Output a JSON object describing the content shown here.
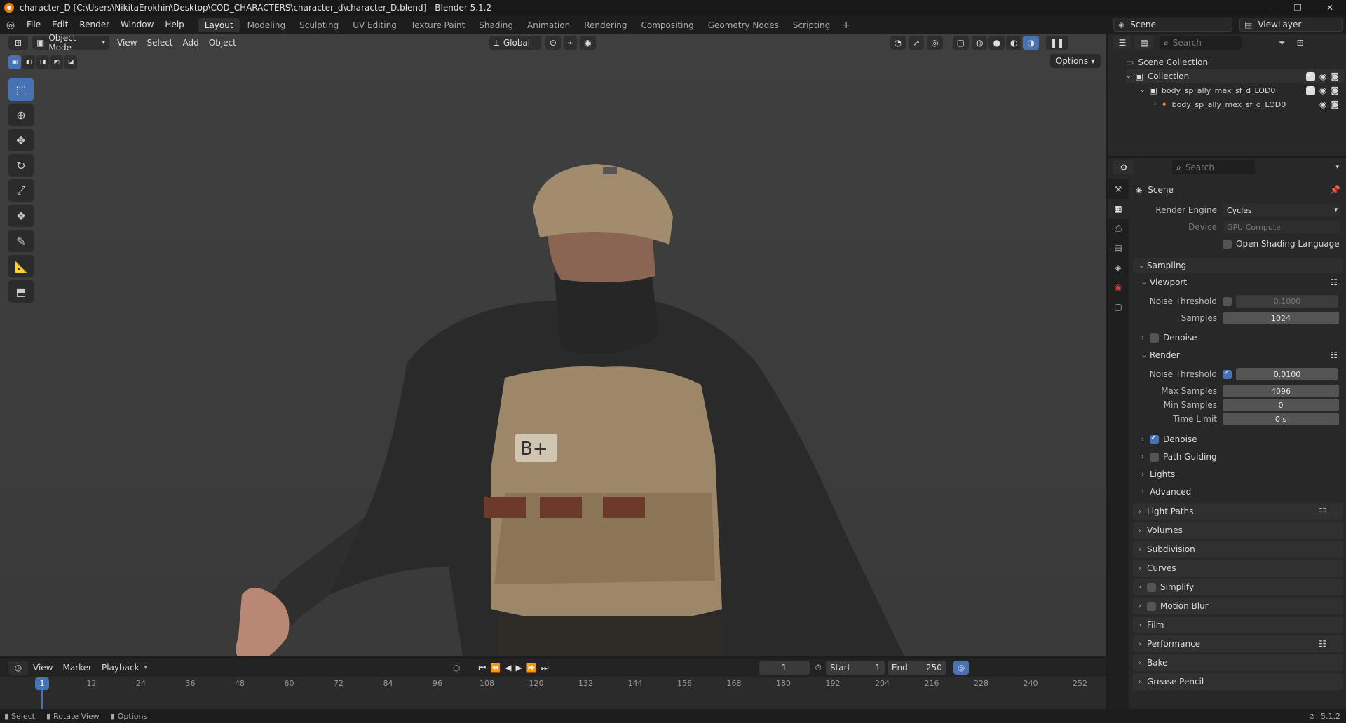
{
  "title": "character_D [C:\\Users\\NikitaErokhin\\Desktop\\COD_CHARACTERS\\character_d\\character_D.blend] - Blender 5.1.2",
  "menus": [
    "File",
    "Edit",
    "Render",
    "Window",
    "Help"
  ],
  "workspaces": [
    "Layout",
    "Modeling",
    "Sculpting",
    "UV Editing",
    "Texture Paint",
    "Shading",
    "Animation",
    "Rendering",
    "Compositing",
    "Geometry Nodes",
    "Scripting"
  ],
  "scene": {
    "name": "Scene",
    "view_layer": "ViewLayer"
  },
  "viewport": {
    "mode": "Object Mode",
    "menus": [
      "View",
      "Select",
      "Add",
      "Object"
    ],
    "transform": "Global",
    "options": "Options"
  },
  "outliner": {
    "search_placeholder": "Search",
    "root": "Scene Collection",
    "collection": "Collection",
    "object": "body_sp_ally_mex_sf_d_LOD0",
    "armature": "body_sp_ally_mex_sf_d_LOD0"
  },
  "props": {
    "search_placeholder": "Search",
    "context": "Scene",
    "render_engine_label": "Render Engine",
    "render_engine": "Cycles",
    "device_label": "Device",
    "device": "GPU Compute",
    "osl": "Open Shading Language",
    "sampling": "Sampling",
    "viewport": "Viewport",
    "vp_noise_label": "Noise Threshold",
    "vp_noise": "0.1000",
    "vp_samples_label": "Samples",
    "vp_samples": "1024",
    "denoise": "Denoise",
    "render": "Render",
    "r_noise_label": "Noise Threshold",
    "r_noise": "0.0100",
    "max_samples_label": "Max Samples",
    "max_samples": "4096",
    "min_samples_label": "Min Samples",
    "min_samples": "0",
    "time_limit_label": "Time Limit",
    "time_limit": "0 s",
    "r_denoise": "Denoise",
    "path_guiding": "Path Guiding",
    "lights": "Lights",
    "advanced": "Advanced",
    "panels": [
      "Light Paths",
      "Volumes",
      "Subdivision",
      "Curves",
      "Simplify",
      "Motion Blur",
      "Film",
      "Performance",
      "Bake",
      "Grease Pencil"
    ]
  },
  "timeline": {
    "menus": [
      "View",
      "Marker",
      "Playback"
    ],
    "current_frame": "1",
    "start_label": "Start",
    "start": "1",
    "end_label": "End",
    "end": "250",
    "ticks": [
      "12",
      "24",
      "36",
      "48",
      "60",
      "72",
      "84",
      "96",
      "108",
      "120",
      "132",
      "144",
      "156",
      "168",
      "180",
      "192",
      "204",
      "216",
      "228",
      "240",
      "252"
    ],
    "playhead": "1"
  },
  "status": {
    "select": "Select",
    "rotate": "Rotate View",
    "options": "Options",
    "version": "5.1.2"
  }
}
